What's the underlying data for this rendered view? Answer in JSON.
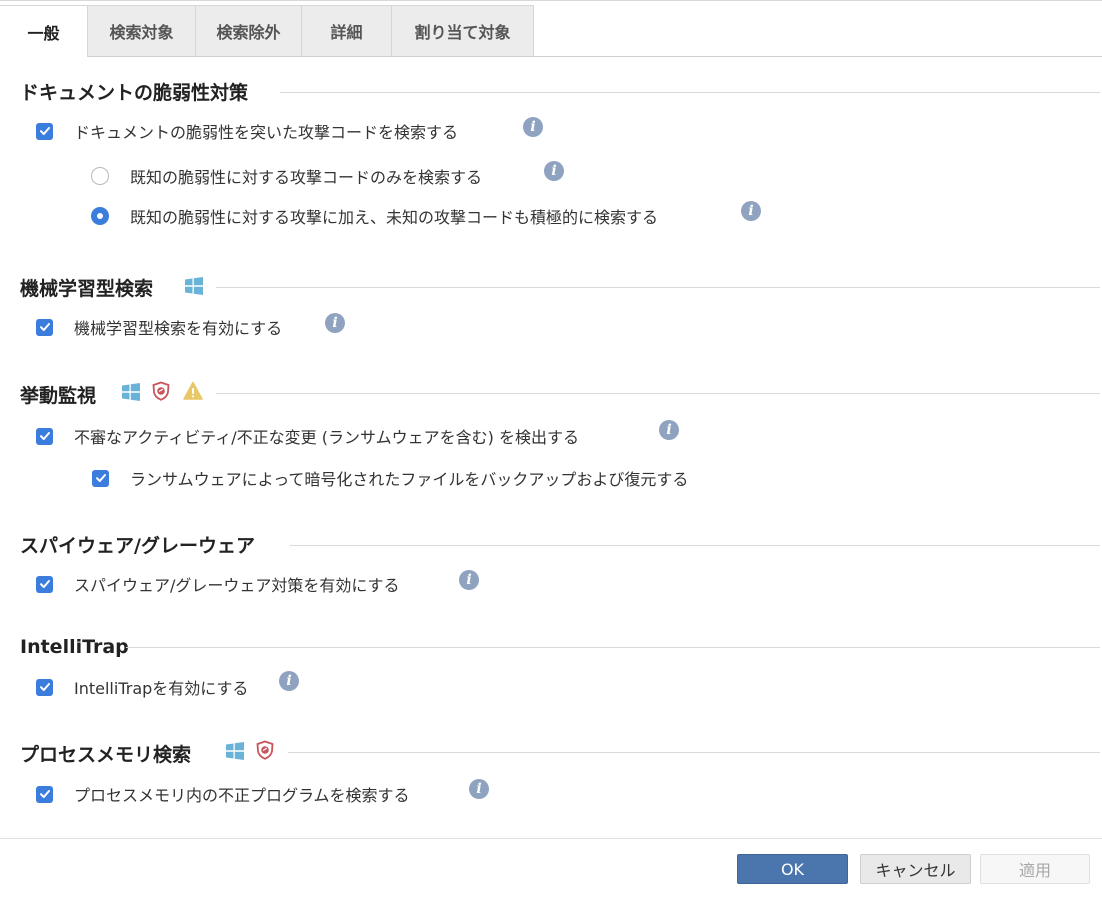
{
  "tabs": [
    {
      "label": "一般",
      "active": true
    },
    {
      "label": "検索対象",
      "active": false
    },
    {
      "label": "検索除外",
      "active": false
    },
    {
      "label": "詳細",
      "active": false
    },
    {
      "label": "割り当て対象",
      "active": false
    }
  ],
  "sections": {
    "document": {
      "title": "ドキュメントの脆弱性対策",
      "checkbox_label": "ドキュメントの脆弱性を突いた攻撃コードを検索する",
      "checked": true,
      "radio_known_label": "既知の脆弱性に対する攻撃コードのみを検索する",
      "radio_known_selected": false,
      "radio_unknown_label": "既知の脆弱性に対する攻撃に加え、未知の攻撃コードも積極的に検索する",
      "radio_unknown_selected": true
    },
    "ml": {
      "title": "機械学習型検索",
      "badges": [
        "windows-icon"
      ],
      "checkbox_label": "機械学習型検索を有効にする",
      "checked": true
    },
    "behavior": {
      "title": "挙動監視",
      "badges": [
        "windows-icon",
        "shield-icon",
        "warning-icon"
      ],
      "checkbox_label": "不審なアクティビティ/不正な変更 (ランサムウェアを含む) を検出する",
      "checked": true,
      "sub_checkbox_label": "ランサムウェアによって暗号化されたファイルをバックアップおよび復元する",
      "sub_checked": true
    },
    "spyware": {
      "title": "スパイウェア/グレーウェア",
      "checkbox_label": "スパイウェア/グレーウェア対策を有効にする",
      "checked": true
    },
    "intellitrap": {
      "title": "IntelliTrap",
      "checkbox_label": "IntelliTrapを有効にする",
      "checked": true
    },
    "memory": {
      "title": "プロセスメモリ検索",
      "badges": [
        "windows-icon",
        "shield-icon"
      ],
      "checkbox_label": "プロセスメモリ内の不正プログラムを検索する",
      "checked": true
    }
  },
  "info_icon_glyph": "i",
  "buttons": {
    "ok": "OK",
    "cancel": "キャンセル",
    "apply": "適用"
  },
  "colors": {
    "accent": "#3b7ddd",
    "ok_button": "#4a76ad",
    "info_icon": "#8fa3c0",
    "windows_icon": "#6ab3d8",
    "shield_icon": "#c9545a",
    "warning_icon": "#e7c766"
  }
}
